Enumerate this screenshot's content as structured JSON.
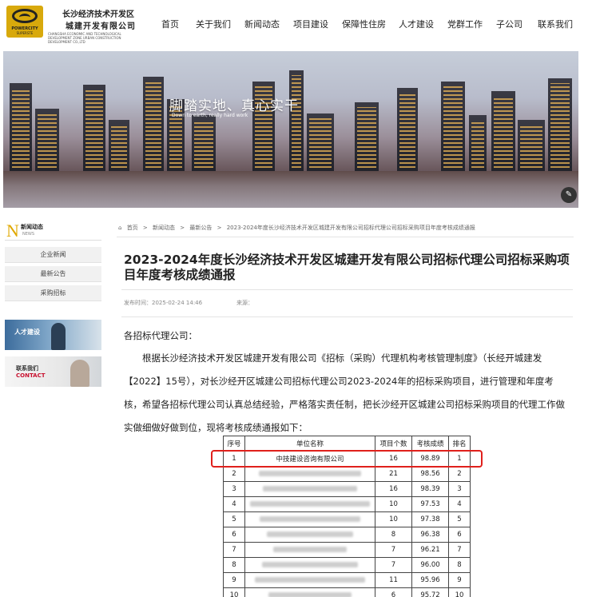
{
  "header": {
    "logo": {
      "line1": "POWERCITY",
      "line2": "SUPERSTE"
    },
    "company_line1": "长沙经济技术开发区",
    "company_line2": "城建开发有限公司",
    "company_en": "CHANGSHA ECONOMIC AND TECHNOLOGICAL DEVELOPMENT ZONE URBAN CONSTRUCTION DEVELOPMENT CO.,LTD",
    "nav": [
      "首页",
      "关于我们",
      "新闻动态",
      "项目建设",
      "保障性住房",
      "人才建设",
      "党群工作",
      "子公司",
      "联系我们"
    ]
  },
  "banner": {
    "slogan": "脚踏实地、真心实干",
    "slogan_en": "Down to earth, really hard work"
  },
  "sidebar": {
    "title_letter": "N",
    "title_cn": "新闻动态",
    "title_en": "NEWS",
    "items": [
      "企业新闻",
      "最新公告",
      "采购招标"
    ],
    "hr_card": "人才建设",
    "contact_cn": "联系我们",
    "contact_en": "CONTACT"
  },
  "breadcrumb": {
    "home": "首页",
    "sep": ">",
    "l1": "新闻动态",
    "l2": "最新公告",
    "current": "2023-2024年度长沙经济技术开发区城建开发有限公司招标代理公司招标采购项目年度考核成绩通报"
  },
  "article": {
    "title": "2023-2024年度长沙经济技术开发区城建开发有限公司招标代理公司招标采购项目年度考核成绩通报",
    "published_label": "发布时间：2025-02-24 14:46",
    "source_label": "来源：",
    "salutation": "各招标代理公司：",
    "body": "根据长沙经济技术开发区城建开发有限公司《招标（采购）代理机构考核管理制度》（长经开城建发【2022】15号），对长沙经开区城建公司招标代理公司2023-2024年的招标采购项目，进行管理和年度考核，希望各招标代理公司认真总结经验，严格落实责任制，把长沙经开区城建公司招标采购项目的代理工作做实做细做好做到位，现将考核成绩通报如下："
  },
  "table": {
    "headers": [
      "序号",
      "单位名称",
      "项目个数",
      "考核成绩",
      "排名"
    ],
    "rows": [
      {
        "no": "1",
        "name": "中技建设咨询有限公司",
        "count": "16",
        "score": "98.89",
        "rank": "1"
      },
      {
        "no": "2",
        "name": "",
        "count": "21",
        "score": "98.56",
        "rank": "2"
      },
      {
        "no": "3",
        "name": "",
        "count": "16",
        "score": "98.39",
        "rank": "3"
      },
      {
        "no": "4",
        "name": "",
        "count": "10",
        "score": "97.53",
        "rank": "4"
      },
      {
        "no": "5",
        "name": "",
        "count": "10",
        "score": "97.38",
        "rank": "5"
      },
      {
        "no": "6",
        "name": "",
        "count": "8",
        "score": "96.38",
        "rank": "6"
      },
      {
        "no": "7",
        "name": "",
        "count": "7",
        "score": "96.21",
        "rank": "7"
      },
      {
        "no": "8",
        "name": "",
        "count": "7",
        "score": "96.00",
        "rank": "8"
      },
      {
        "no": "9",
        "name": "",
        "count": "11",
        "score": "95.96",
        "rank": "9"
      },
      {
        "no": "10",
        "name": "",
        "count": "6",
        "score": "95.72",
        "rank": "10"
      }
    ]
  },
  "colors": {
    "highlight": "#e0201c",
    "accent": "#e0a800",
    "contact": "#c8102e"
  }
}
